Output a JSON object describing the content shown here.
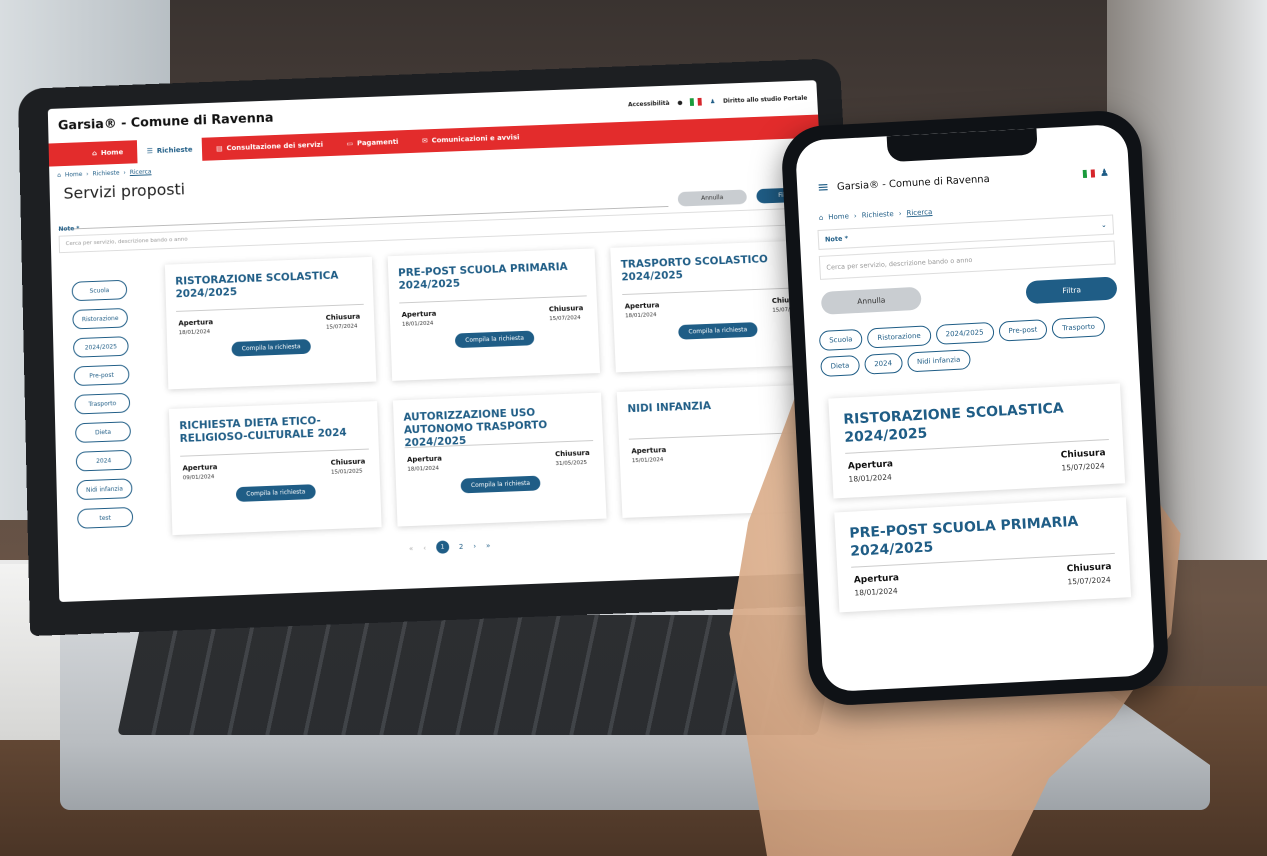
{
  "laptop": {
    "app_title": "Garsia® - Comune di Ravenna",
    "util": {
      "accessibility": "Accessibilità",
      "link": "Diritto allo studio Portale"
    },
    "nav": [
      {
        "label": "Home",
        "icon": "home-icon"
      },
      {
        "label": "Richieste",
        "icon": "list-icon"
      },
      {
        "label": "Consultazione dei servizi",
        "icon": "document-icon"
      },
      {
        "label": "Pagamenti",
        "icon": "card-icon"
      },
      {
        "label": "Comunicazioni e avvisi",
        "icon": "mail-icon"
      }
    ],
    "breadcrumb": [
      "Home",
      "Richieste",
      "Ricerca"
    ],
    "page_title": "Servizi proposti",
    "note_label": "Note *",
    "search_placeholder": "Cerca per servizio, descrizione bando o anno",
    "annulla": "Annulla",
    "filtra": "Filtra",
    "chips": [
      "Scuola",
      "Ristorazione",
      "2024/2025",
      "Pre-post",
      "Trasporto",
      "Dieta",
      "2024",
      "Nidi infanzia",
      "test"
    ],
    "cards": [
      {
        "title": "RISTORAZIONE SCOLASTICA 2024/2025",
        "open_label": "Apertura",
        "open": "18/01/2024",
        "close_label": "Chiusura",
        "close": "15/07/2024",
        "button": "Compila la richiesta"
      },
      {
        "title": "PRE-POST SCUOLA PRIMARIA 2024/2025",
        "open_label": "Apertura",
        "open": "18/01/2024",
        "close_label": "Chiusura",
        "close": "15/07/2024",
        "button": "Compila la richiesta"
      },
      {
        "title": "TRASPORTO SCOLASTICO 2024/2025",
        "open_label": "Apertura",
        "open": "18/01/2024",
        "close_label": "Chiusura",
        "close": "15/07/",
        "button": "Compila la richiesta"
      },
      {
        "title": "RICHIESTA DIETA ETICO-RELIGIOSO-CULTURALE 2024",
        "open_label": "Apertura",
        "open": "09/01/2024",
        "close_label": "Chiusura",
        "close": "15/01/2025",
        "button": "Compila la richiesta"
      },
      {
        "title": "AUTORIZZAZIONE USO AUTONOMO TRASPORTO 2024/2025",
        "open_label": "Apertura",
        "open": "18/01/2024",
        "close_label": "Chiusura",
        "close": "31/05/2025",
        "button": "Compila la richiesta"
      },
      {
        "title": "NIDI INFANZIA",
        "open_label": "Apertura",
        "open": "15/01/2024",
        "close_label": "",
        "close": "",
        "button": ""
      }
    ],
    "pager": {
      "first": "«",
      "prev": "‹",
      "pages": [
        "1",
        "2"
      ],
      "next": "›",
      "last": "»"
    }
  },
  "phone": {
    "app_title": "Garsia® - Comune di Ravenna",
    "breadcrumb": [
      "Home",
      "Richieste",
      "Ricerca"
    ],
    "note_label": "Note *",
    "search_placeholder": "Cerca per servizio, descrizione bando o anno",
    "annulla": "Annulla",
    "filtra": "Filtra",
    "chips": [
      "Scuola",
      "Ristorazione",
      "2024/2025",
      "Pre-post",
      "Trasporto",
      "Dieta",
      "2024",
      "Nidi infanzia"
    ],
    "cards": [
      {
        "title": "RISTORAZIONE SCOLASTICA 2024/2025",
        "open_label": "Apertura",
        "open": "18/01/2024",
        "close_label": "Chiusura",
        "close": "15/07/2024"
      },
      {
        "title": "PRE-POST SCUOLA PRIMARIA 2024/2025",
        "open_label": "Apertura",
        "open": "18/01/2024",
        "close_label": "Chiusura",
        "close": "15/07/2024"
      }
    ]
  },
  "colors": {
    "brand_red": "#e32c2c",
    "brand_blue": "#1f5d86"
  }
}
